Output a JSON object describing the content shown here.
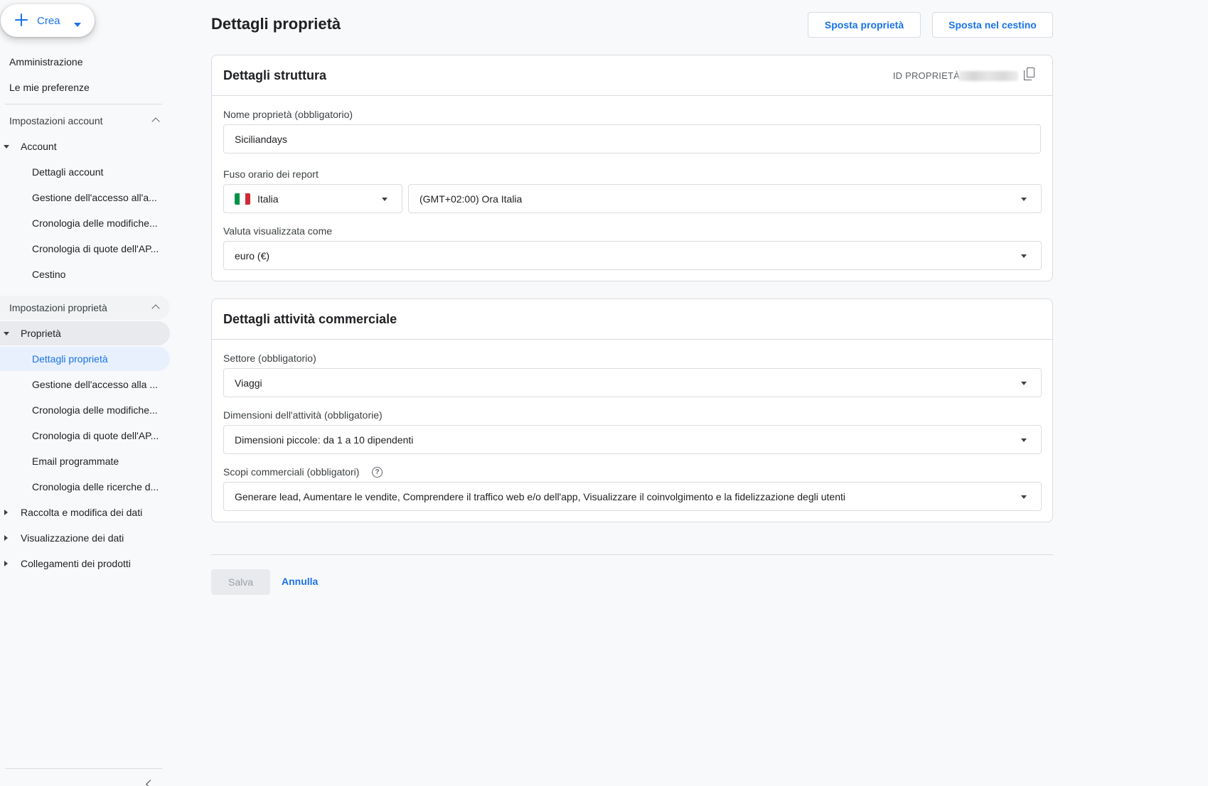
{
  "create": {
    "label": "Crea"
  },
  "sidebar": {
    "top": [
      "Amministrazione",
      "Le mie preferenze"
    ],
    "account_section": "Impostazioni account",
    "account_group": "Account",
    "account_items": [
      "Dettagli account",
      "Gestione dell'accesso all'a...",
      "Cronologia delle modifiche...",
      "Cronologia di quote dell'AP...",
      "Cestino"
    ],
    "property_section": "Impostazioni proprietà",
    "property_group": "Proprietà",
    "property_items": [
      "Dettagli proprietà",
      "Gestione dell'accesso alla ...",
      "Cronologia delle modifiche...",
      "Cronologia di quote dell'AP...",
      "Email programmate",
      "Cronologia delle ricerche d..."
    ],
    "collapsed_groups": [
      "Raccolta e modifica dei dati",
      "Visualizzazione dei dati",
      "Collegamenti dei prodotti"
    ]
  },
  "header": {
    "title": "Dettagli proprietà",
    "move_button": "Sposta proprietà",
    "trash_button": "Sposta nel cestino"
  },
  "structure": {
    "title": "Dettagli struttura",
    "property_id_label": "ID PROPRIETÀ",
    "name_label": "Nome proprietà (obbligatorio)",
    "name_value": "Siciliandays",
    "timezone_label": "Fuso orario dei report",
    "country_value": "Italia",
    "timezone_value": "(GMT+02:00) Ora Italia",
    "currency_label": "Valuta visualizzata come",
    "currency_value": "euro (€)"
  },
  "business": {
    "title": "Dettagli attività commerciale",
    "sector_label": "Settore (obbligatorio)",
    "sector_value": "Viaggi",
    "size_label": "Dimensioni dell'attività (obbligatorie)",
    "size_value": "Dimensioni piccole: da 1 a 10 dipendenti",
    "goals_label": "Scopi commerciali (obbligatori)",
    "goals_value": "Generare lead, Aumentare le vendite, Comprendere il traffico web e/o dell'app, Visualizzare il coinvolgimento e la fidelizzazione degli utenti",
    "help_glyph": "?"
  },
  "actions": {
    "save": "Salva",
    "cancel": "Annulla"
  },
  "colors": {
    "accent": "#1a73e8",
    "active_bg": "#e8f0fe",
    "flag": [
      "#009246",
      "#ffffff",
      "#ce2b37"
    ]
  },
  "icons": [
    "plus-icon",
    "caret-down-icon",
    "chevron-up-icon",
    "triangle-down-icon",
    "triangle-right-icon",
    "copy-icon",
    "help-icon",
    "chevron-left-icon",
    "italy-flag-icon"
  ]
}
